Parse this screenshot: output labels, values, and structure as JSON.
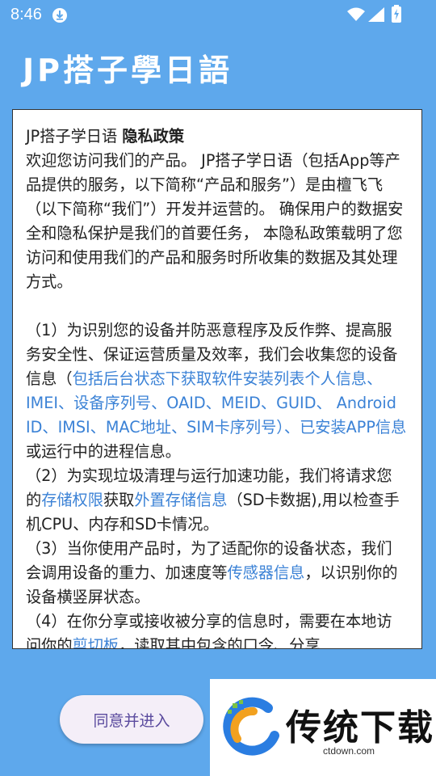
{
  "status_bar": {
    "time": "8:46"
  },
  "app": {
    "title": "JP搭子學日語"
  },
  "policy": {
    "header_app": "JP搭子学日语 ",
    "header_title": "隐私政策",
    "intro": "欢迎您访问我们的产品。 JP搭子学日语（包括App等产品提供的服务，以下简称“产品和服务”）是由檀飞飞 （以下简称“我们”）开发并运营的。 确保用户的数据安全和隐私保护是我们的首要任务， 本隐私政策载明了您访问和使用我们的产品和服务时所收集的数据及其处理方式。",
    "p1_a": "（1）为识别您的设备并防恶意程序及反作弊、提高服务安全性、保证运营质量及效率，我们会收集您的设备信息（",
    "p1_link": "包括后台状态下获取软件安装列表个人信息、IMEI、设备序列号、OAID、MEID、GUID、 Android ID、IMSI、MAC地址、SIM卡序列号）、已安装APP信息",
    "p1_b": "或运行中的进程信息。",
    "p2_a": "（2）为实现垃圾清理与运行加速功能，我们将请求您的",
    "p2_link1": "存储权限",
    "p2_b": "获取",
    "p2_link2": "外置存储信息",
    "p2_c": "（SD卡数据),用以检查手机CPU、内存和SD卡情况。",
    "p3_a": "（3）当你使用产品时，为了适配你的设备状态，我们会调用设备的重力、加速度等",
    "p3_link": "传感器信息",
    "p3_b": "，以识别你的设备横竖屏状态。",
    "p4_a": "（4）在你分享或接收被分享的信息时，需要在本地访问你的",
    "p4_link": "剪切板",
    "p4_b": "，读取其中包含的口令、分享"
  },
  "buttons": {
    "agree": "同意并进入"
  },
  "watermark": {
    "brand": "传统下载",
    "url": "ctdown.com"
  },
  "icons": [
    "download-icon",
    "wifi-icon",
    "signal-icon",
    "battery-icon"
  ],
  "colors": {
    "background": "#5ea8ec",
    "link": "#3b82d6",
    "button_text": "#5a4a9e"
  }
}
